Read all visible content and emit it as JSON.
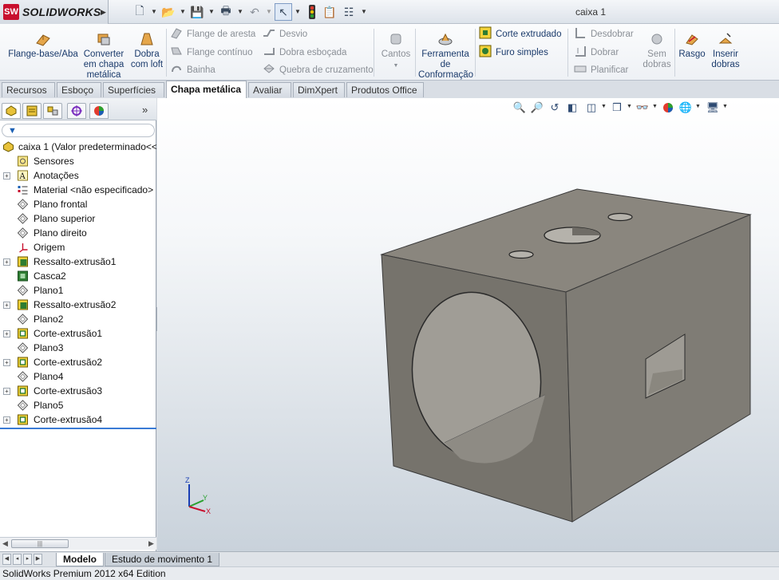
{
  "app": {
    "brand": "SOLIDWORKS",
    "logo_mark": "SW",
    "document_title": "caixa 1"
  },
  "quick_access": {
    "icons": [
      "new-document-icon",
      "open-folder-icon",
      "save-icon",
      "print-icon",
      "undo-icon",
      "select-arrow-icon",
      "rebuild-traffic-light-icon",
      "file-properties-icon",
      "options-icon"
    ]
  },
  "ribbon": {
    "flange_base": "Flange-base/Aba",
    "convert_line1": "Converter",
    "convert_line2": "em chapa",
    "convert_line3": "metálica",
    "loft_line1": "Dobra",
    "loft_line2": "com loft",
    "edge_flange": "Flange de aresta",
    "miter_flange": "Flange contínuo",
    "hem": "Bainha",
    "jog": "Desvio",
    "sketched_bend": "Dobra esboçada",
    "cross_break": "Quebra de cruzamento",
    "corners": "Cantos",
    "forming_line1": "Ferramenta",
    "forming_line2": "de",
    "forming_line3": "Conformação",
    "extruded_cut": "Corte extrudado",
    "simple_hole": "Furo simples",
    "unfold": "Desdobrar",
    "fold": "Dobrar",
    "flatten": "Planificar",
    "no_bends_line1": "Sem",
    "no_bends_line2": "dobras",
    "rip": "Rasgo",
    "insert_bends_line1": "Inserir",
    "insert_bends_line2": "dobras"
  },
  "tabs": [
    "Recursos",
    "Esboço",
    "Superfícies",
    "Chapa metálica",
    "Avaliar",
    "DimXpert",
    "Produtos Office"
  ],
  "active_tab": "Chapa metálica",
  "feature_tree": {
    "root": "caixa 1  (Valor predeterminado<<",
    "items": [
      {
        "label": "Sensores",
        "icon": "sensor-icon",
        "expandable": false
      },
      {
        "label": "Anotações",
        "icon": "annotations-icon",
        "expandable": true
      },
      {
        "label": "Material <não especificado>",
        "icon": "material-icon",
        "expandable": false
      },
      {
        "label": "Plano frontal",
        "icon": "plane-icon",
        "expandable": false
      },
      {
        "label": "Plano superior",
        "icon": "plane-icon",
        "expandable": false
      },
      {
        "label": "Plano direito",
        "icon": "plane-icon",
        "expandable": false
      },
      {
        "label": "Origem",
        "icon": "origin-icon",
        "expandable": false
      },
      {
        "label": "Ressalto-extrusão1",
        "icon": "boss-extrude-icon",
        "expandable": true
      },
      {
        "label": "Casca2",
        "icon": "shell-icon",
        "expandable": false
      },
      {
        "label": "Plano1",
        "icon": "plane-icon",
        "expandable": false
      },
      {
        "label": "Ressalto-extrusão2",
        "icon": "boss-extrude-icon",
        "expandable": true
      },
      {
        "label": "Plano2",
        "icon": "plane-icon",
        "expandable": false
      },
      {
        "label": "Corte-extrusão1",
        "icon": "cut-extrude-icon",
        "expandable": true
      },
      {
        "label": "Plano3",
        "icon": "plane-icon",
        "expandable": false
      },
      {
        "label": "Corte-extrusão2",
        "icon": "cut-extrude-icon",
        "expandable": true
      },
      {
        "label": "Plano4",
        "icon": "plane-icon",
        "expandable": false
      },
      {
        "label": "Corte-extrusão3",
        "icon": "cut-extrude-icon",
        "expandable": true
      },
      {
        "label": "Plano5",
        "icon": "plane-icon",
        "expandable": false
      },
      {
        "label": "Corte-extrusão4",
        "icon": "cut-extrude-icon",
        "expandable": true
      }
    ]
  },
  "bottom_tabs": [
    "Modelo",
    "Estudo de movimento 1"
  ],
  "status": "SolidWorks Premium 2012 x64 Edition",
  "triad": {
    "z": "Z",
    "y": "Y",
    "x": "X"
  },
  "colors": {
    "accent": "#1a3a6b",
    "model_face": "#7d7a73",
    "viewport_top": "#ffffff",
    "viewport_bottom": "#c9d2db"
  }
}
